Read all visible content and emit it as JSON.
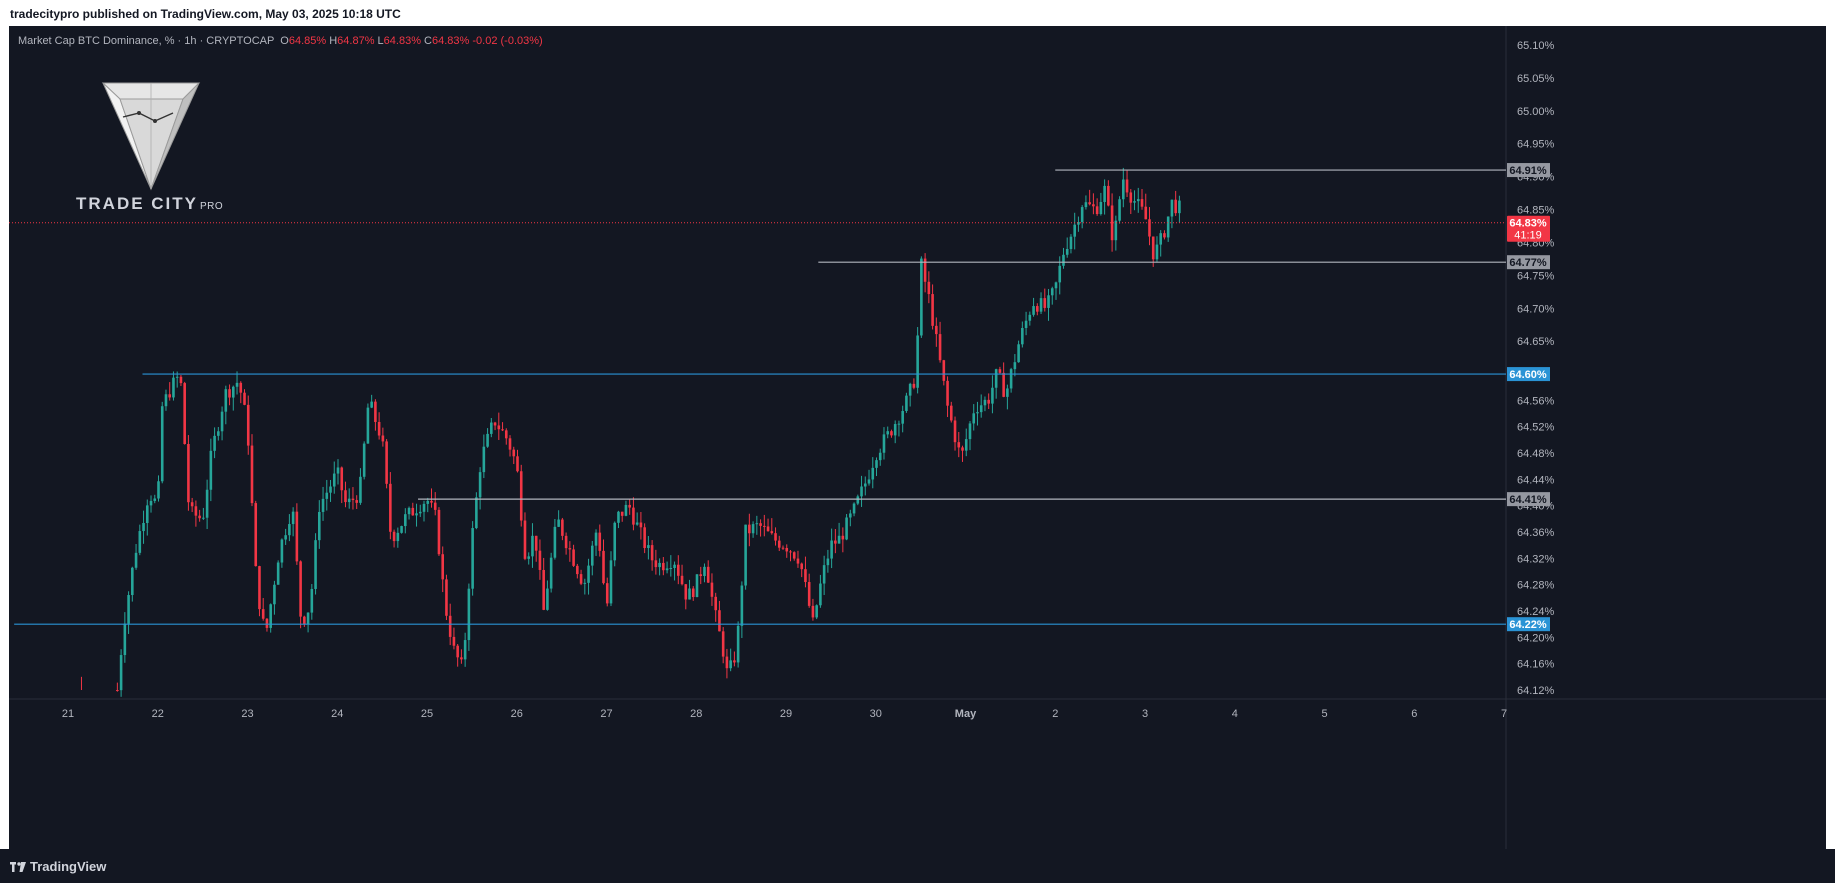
{
  "header": {
    "published_by": "tradecitypro published on TradingView.com, May 03, 2025 10:18 UTC"
  },
  "legend": {
    "symbol": "Market Cap BTC Dominance, % · 1h · CRYPTOCAP",
    "open_label": "O",
    "open": "64.85%",
    "high_label": "H",
    "high": "64.87%",
    "low_label": "L",
    "low": "64.83%",
    "close_label": "C",
    "close": "64.83%",
    "change": "-0.02 (-0.03%)"
  },
  "brand": {
    "name": "TRADE CITY",
    "suffix": "PRO"
  },
  "footer": {
    "logo_text": "TradingView"
  },
  "colors": {
    "up": "#26a69a",
    "down": "#f23645",
    "level_white": "#b2b5be",
    "level_blue": "#2a93d5",
    "background": "#131722"
  },
  "chart_data": {
    "type": "candlestick",
    "ylim": [
      64.1,
      65.12
    ],
    "y_ticks": [
      "65.10%",
      "65.05%",
      "65.00%",
      "64.95%",
      "64.90%",
      "64.85%",
      "64.80%",
      "64.75%",
      "64.70%",
      "64.65%",
      "64.56%",
      "64.52%",
      "64.48%",
      "64.44%",
      "64.40%",
      "64.36%",
      "64.32%",
      "64.28%",
      "64.24%",
      "64.20%",
      "64.16%",
      "64.12%"
    ],
    "y_tick_values": [
      65.1,
      65.05,
      65.0,
      64.95,
      64.9,
      64.85,
      64.8,
      64.75,
      64.7,
      64.65,
      64.56,
      64.52,
      64.48,
      64.44,
      64.4,
      64.36,
      64.32,
      64.28,
      64.24,
      64.2,
      64.16,
      64.12
    ],
    "x_labels": [
      {
        "label": "21",
        "day": 21
      },
      {
        "label": "22",
        "day": 22
      },
      {
        "label": "23",
        "day": 23
      },
      {
        "label": "24",
        "day": 24
      },
      {
        "label": "25",
        "day": 25
      },
      {
        "label": "26",
        "day": 26
      },
      {
        "label": "27",
        "day": 27
      },
      {
        "label": "28",
        "day": 28
      },
      {
        "label": "29",
        "day": 29
      },
      {
        "label": "30",
        "day": 30
      },
      {
        "label": "May",
        "day": 31
      },
      {
        "label": "2",
        "day": 32
      },
      {
        "label": "3",
        "day": 33
      },
      {
        "label": "4",
        "day": 34
      },
      {
        "label": "5",
        "day": 35
      },
      {
        "label": "6",
        "day": 36
      },
      {
        "label": "7",
        "day": 37
      }
    ],
    "levels": [
      {
        "value": 64.91,
        "label": "64.91%",
        "color": "white",
        "from_day": 32.0
      },
      {
        "value": 64.77,
        "label": "64.77%",
        "color": "white",
        "from_day": 29.36
      },
      {
        "value": 64.6,
        "label": "64.60%",
        "color": "blue",
        "from_day": 21.83
      },
      {
        "value": 64.41,
        "label": "64.41%",
        "color": "white",
        "from_day": 24.9
      },
      {
        "value": 64.22,
        "label": "64.22%",
        "color": "blue",
        "from_day": 20.4
      }
    ],
    "last_price": {
      "value": 64.83,
      "label": "64.83%",
      "countdown": "41:19"
    },
    "price_path": [
      [
        21.1,
        64.13
      ],
      [
        21.55,
        64.12
      ],
      [
        21.62,
        64.22
      ],
      [
        21.75,
        64.33
      ],
      [
        21.9,
        64.42
      ],
      [
        22.0,
        64.4
      ],
      [
        22.05,
        64.55
      ],
      [
        22.15,
        64.58
      ],
      [
        22.25,
        64.6
      ],
      [
        22.35,
        64.39
      ],
      [
        22.5,
        64.38
      ],
      [
        22.6,
        64.48
      ],
      [
        22.75,
        64.57
      ],
      [
        22.9,
        64.59
      ],
      [
        23.0,
        64.52
      ],
      [
        23.1,
        64.28
      ],
      [
        23.2,
        64.2
      ],
      [
        23.35,
        64.33
      ],
      [
        23.5,
        64.4
      ],
      [
        23.6,
        64.22
      ],
      [
        23.7,
        64.25
      ],
      [
        23.8,
        64.4
      ],
      [
        24.0,
        64.45
      ],
      [
        24.1,
        64.4
      ],
      [
        24.25,
        64.42
      ],
      [
        24.35,
        64.56
      ],
      [
        24.5,
        64.5
      ],
      [
        24.6,
        64.35
      ],
      [
        24.75,
        64.38
      ],
      [
        24.9,
        64.4
      ],
      [
        25.0,
        64.41
      ],
      [
        25.1,
        64.38
      ],
      [
        25.2,
        64.25
      ],
      [
        25.3,
        64.18
      ],
      [
        25.4,
        64.15
      ],
      [
        25.5,
        64.35
      ],
      [
        25.6,
        64.47
      ],
      [
        25.75,
        64.53
      ],
      [
        25.9,
        64.5
      ],
      [
        26.0,
        64.46
      ],
      [
        26.1,
        64.32
      ],
      [
        26.2,
        64.36
      ],
      [
        26.3,
        64.24
      ],
      [
        26.45,
        64.38
      ],
      [
        26.6,
        64.33
      ],
      [
        26.75,
        64.28
      ],
      [
        26.9,
        64.37
      ],
      [
        27.0,
        64.24
      ],
      [
        27.1,
        64.38
      ],
      [
        27.25,
        64.4
      ],
      [
        27.4,
        64.35
      ],
      [
        27.5,
        64.32
      ],
      [
        27.6,
        64.31
      ],
      [
        27.75,
        64.32
      ],
      [
        27.9,
        64.26
      ],
      [
        28.0,
        64.28
      ],
      [
        28.1,
        64.32
      ],
      [
        28.2,
        64.24
      ],
      [
        28.3,
        64.18
      ],
      [
        28.35,
        64.14
      ],
      [
        28.45,
        64.18
      ],
      [
        28.55,
        64.36
      ],
      [
        28.7,
        64.37
      ],
      [
        28.85,
        64.35
      ],
      [
        29.0,
        64.34
      ],
      [
        29.15,
        64.32
      ],
      [
        29.3,
        64.22
      ],
      [
        29.4,
        64.29
      ],
      [
        29.5,
        64.34
      ],
      [
        29.6,
        64.35
      ],
      [
        29.75,
        64.39
      ],
      [
        29.9,
        64.44
      ],
      [
        30.0,
        64.48
      ],
      [
        30.15,
        64.51
      ],
      [
        30.35,
        64.56
      ],
      [
        30.45,
        64.6
      ],
      [
        30.5,
        64.77
      ],
      [
        30.6,
        64.71
      ],
      [
        30.7,
        64.63
      ],
      [
        30.8,
        64.55
      ],
      [
        30.95,
        64.47
      ],
      [
        31.1,
        64.55
      ],
      [
        31.25,
        64.56
      ],
      [
        31.35,
        64.6
      ],
      [
        31.45,
        64.57
      ],
      [
        31.6,
        64.65
      ],
      [
        31.75,
        64.71
      ],
      [
        31.9,
        64.7
      ],
      [
        32.0,
        64.73
      ],
      [
        32.1,
        64.79
      ],
      [
        32.2,
        64.82
      ],
      [
        32.3,
        64.86
      ],
      [
        32.45,
        64.85
      ],
      [
        32.55,
        64.88
      ],
      [
        32.65,
        64.8
      ],
      [
        32.75,
        64.9
      ],
      [
        32.85,
        64.87
      ],
      [
        33.0,
        64.84
      ],
      [
        33.1,
        64.78
      ],
      [
        33.2,
        64.81
      ],
      [
        33.3,
        64.86
      ],
      [
        33.4,
        64.85
      ]
    ]
  }
}
